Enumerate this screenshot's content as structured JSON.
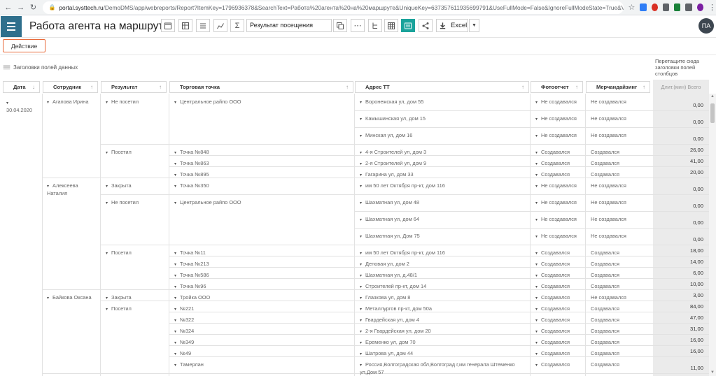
{
  "browser": {
    "url_domain": "portal.systtech.ru",
    "url_rest": "/DemoDMS/app/webreports/Report?ItemKey=1796936378&SearchText=Работа%20агента%20на%20маршруте&UniqueKey=637357611935699791&UseFullMode=False&IgnoreFullModeState=True&ViewType=Pivot"
  },
  "header": {
    "title": "Работа агента на маршруте",
    "measure_select": "Результат посещения",
    "excel_label": "Excel",
    "avatar_initials": "ПА"
  },
  "actions": {
    "action_label": "Действие"
  },
  "pivot": {
    "data_headers_label": "Заголовки полей данных",
    "column_drop_hint": "Перетащите сюда заголовки полей столбцов",
    "columns": [
      "Дата",
      "Сотрудник",
      "Результат",
      "Торговая точка",
      "Адрес ТТ",
      "Фотоотчет",
      "Мерчандайзинг"
    ],
    "value_header": "Длит.(мин) Всего",
    "date": "30.04.2020",
    "employees": [
      "Агапова Ирина",
      "Алексеева Наталия",
      "Байкова Оксана"
    ],
    "results": [
      "Не посетил",
      "Посетил",
      "Закрыта",
      "Не посетил",
      "Посетил",
      "Закрыта",
      "Посетил"
    ],
    "outlets": [
      "Центральное райпо ООО",
      "Точка №848",
      "Точка №863",
      "Точка №895",
      "Точка №350",
      "Центральное райпо ООО",
      "Точка №11",
      "Точка №213",
      "Точка №586",
      "Точка №96",
      "Тройка ООО",
      "№221",
      "№322",
      "№324",
      "№349",
      "№49",
      "Тамерлан"
    ],
    "rows": [
      {
        "address": "Воронежская ул, дом 55",
        "photo": "Не создавался",
        "merch": "Не создавался",
        "value": "0,00"
      },
      {
        "address": "Камышинская ул, дом 15",
        "photo": "Не создавался",
        "merch": "Не создавался",
        "value": "0,00"
      },
      {
        "address": "Минская ул, дом 16",
        "photo": "Не создавался",
        "merch": "Не создавался",
        "value": "0,00"
      },
      {
        "address": "4-я Строителей ул, дом 3",
        "photo": "Создавался",
        "merch": "Создавался",
        "value": "26,00"
      },
      {
        "address": "2-я Строителей ул, дом 9",
        "photo": "Создавался",
        "merch": "Создавался",
        "value": "41,00"
      },
      {
        "address": "Гагарина ул, дом 33",
        "photo": "Создавался",
        "merch": "Создавался",
        "value": "20,00"
      },
      {
        "address": "им 50 лет Октября пр-кт, дом 116",
        "photo": "Не создавался",
        "merch": "Не создавался",
        "value": "0,00"
      },
      {
        "address": "Шахматная ул, дом 48",
        "photo": "Не создавался",
        "merch": "Не создавался",
        "value": "0,00"
      },
      {
        "address": "Шахматная ул, дом 64",
        "photo": "Не создавался",
        "merch": "Не создавался",
        "value": "0,00"
      },
      {
        "address": "Шахматная ул, Дом 75",
        "photo": "Не создавался",
        "merch": "Не создавался",
        "value": "0,00"
      },
      {
        "address": "им 50 лет Октября пр-кт, дом 116",
        "photo": "Создавался",
        "merch": "Создавался",
        "value": "18,00"
      },
      {
        "address": "Деповая ул, дом 2",
        "photo": "Создавался",
        "merch": "Создавался",
        "value": "14,00"
      },
      {
        "address": "Шахматная ул, д.48/1",
        "photo": "Создавался",
        "merch": "Создавался",
        "value": "6,00"
      },
      {
        "address": "Строителей пр-кт, дом 14",
        "photo": "Создавался",
        "merch": "Создавался",
        "value": "10,00"
      },
      {
        "address": "Глазкова ул, дом 8",
        "photo": "Создавался",
        "merch": "Не создавался",
        "value": "3,00"
      },
      {
        "address": "Металлургов пр-кт, дом 50а",
        "photo": "Создавался",
        "merch": "Создавался",
        "value": "84,00"
      },
      {
        "address": "Гвардейская ул, дом 4",
        "photo": "Создавался",
        "merch": "Создавался",
        "value": "47,00"
      },
      {
        "address": "2-я Гвардейская ул, дом 20",
        "photo": "Создавался",
        "merch": "Создавался",
        "value": "31,00"
      },
      {
        "address": "Еременко ул, дом 70",
        "photo": "Создавался",
        "merch": "Создавался",
        "value": "16,00"
      },
      {
        "address": "Шатрова ул, дом 44",
        "photo": "Создавался",
        "merch": "Создавался",
        "value": "16,00"
      },
      {
        "address": "Россия,Волгоградская обл,Волгоград г,им генерала Штеменко ул,Дом 57",
        "photo": "Создавался",
        "merch": "Создавался",
        "value": "11,00"
      }
    ]
  }
}
